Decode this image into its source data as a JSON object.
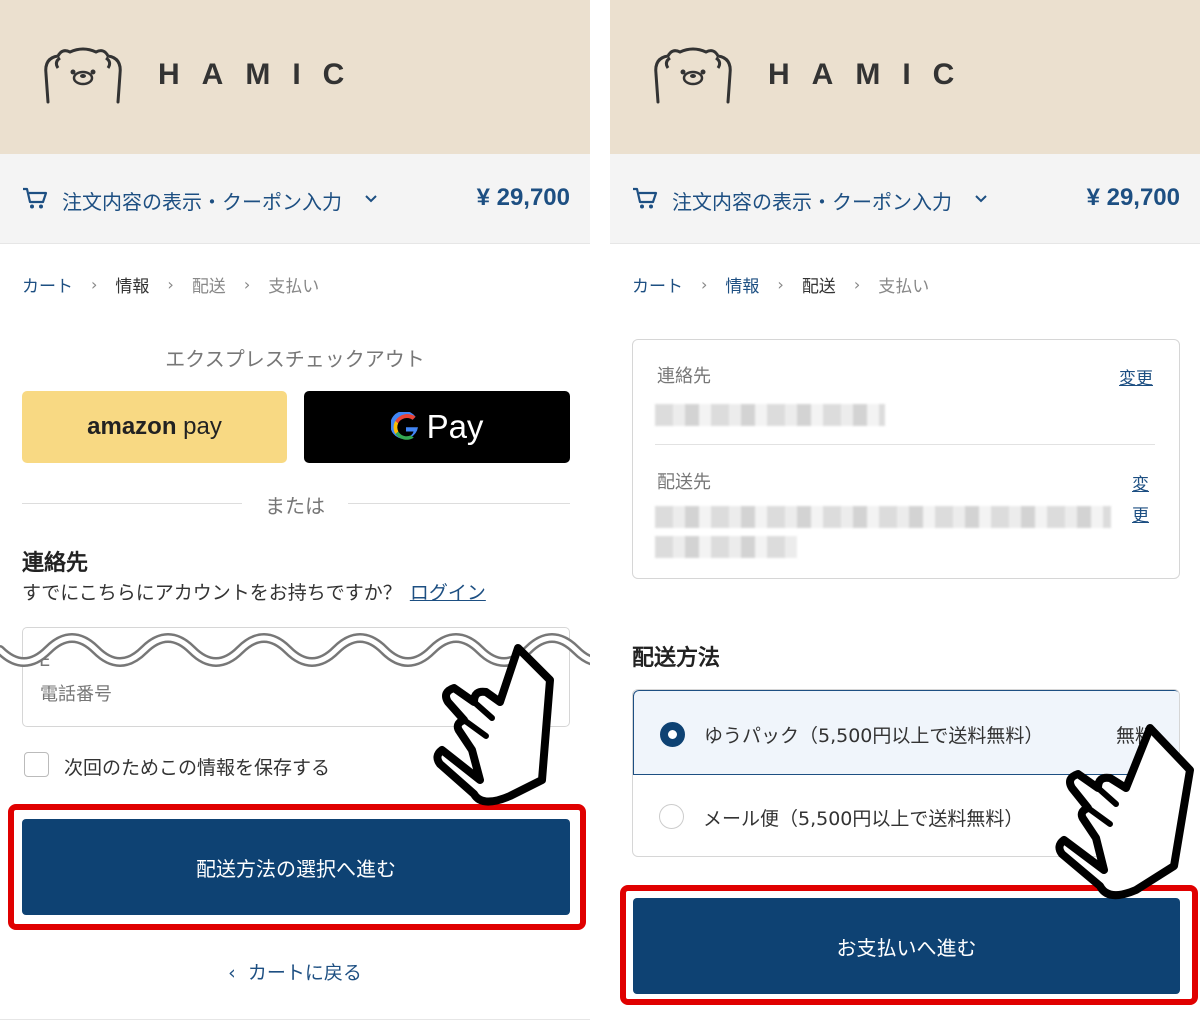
{
  "brand": {
    "name": "HAMIC"
  },
  "summary": {
    "label": "注文内容の表示・クーポン入力",
    "total": "¥ 29,700"
  },
  "breadcrumb": {
    "items": [
      "カート",
      "情報",
      "配送",
      "支払い"
    ]
  },
  "colors": {
    "header_bg": "#ebe0cf",
    "primary": "#0e4273",
    "link": "#1d4f82",
    "highlight_frame": "#e00000",
    "amazon_pay": "#f8d983"
  },
  "left": {
    "express_title": "エクスプレスチェックアウト",
    "amazon_pay_brand": "amazon",
    "amazon_pay_word": "pay",
    "gpay_label": "Pay",
    "or_label": "または",
    "contact_heading": "連絡先",
    "login_question": "すでにこちらにアカウントをお持ちですか？",
    "login_link": "ログイン",
    "input_partial": "E",
    "input_label": "電話番号",
    "save_info_label": "次回のためこの情報を保存する",
    "continue_button": "配送方法の選択へ進む",
    "back_link": "カートに戻る"
  },
  "right": {
    "contact_label": "連絡先",
    "ship_to_label": "配送先",
    "change_label": "変更",
    "change_label_line1": "変",
    "change_label_line2": "更",
    "shipping_heading": "配送方法",
    "options": [
      {
        "label": "ゆうパック（5,500円以上で送料無料）",
        "price": "無料",
        "selected": true
      },
      {
        "label": "メール便（5,500円以上で送料無料）",
        "selected": false
      }
    ],
    "continue_button": "お支払いへ進む"
  }
}
